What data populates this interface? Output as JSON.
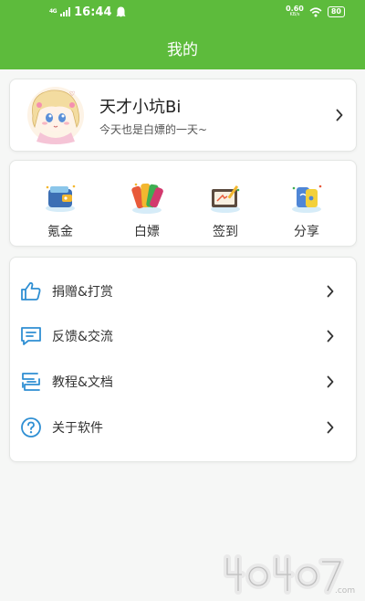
{
  "status_bar": {
    "network_type": "4G",
    "time": "16:44",
    "net_speed": "0.60",
    "net_speed_unit": "KB/s",
    "battery": "80"
  },
  "header": {
    "title": "我的"
  },
  "profile": {
    "name": "天才小坑Bi",
    "motto": "今天也是白嫖的一天~"
  },
  "actions": [
    {
      "label": "氪金",
      "icon": "wallet-icon"
    },
    {
      "label": "白嫖",
      "icon": "cards-icon"
    },
    {
      "label": "签到",
      "icon": "sign-board-icon"
    },
    {
      "label": "分享",
      "icon": "share-icon"
    }
  ],
  "menu": [
    {
      "label": "捐赠&打赏",
      "icon": "thumbs-up-icon"
    },
    {
      "label": "反馈&交流",
      "icon": "message-icon"
    },
    {
      "label": "教程&文档",
      "icon": "document-icon"
    },
    {
      "label": "关于软件",
      "icon": "help-icon"
    }
  ],
  "watermark": {
    "text": "4o4o7.com"
  },
  "colors": {
    "header_green": "#5dbb3c",
    "menu_icon_blue": "#2f8fd3"
  }
}
